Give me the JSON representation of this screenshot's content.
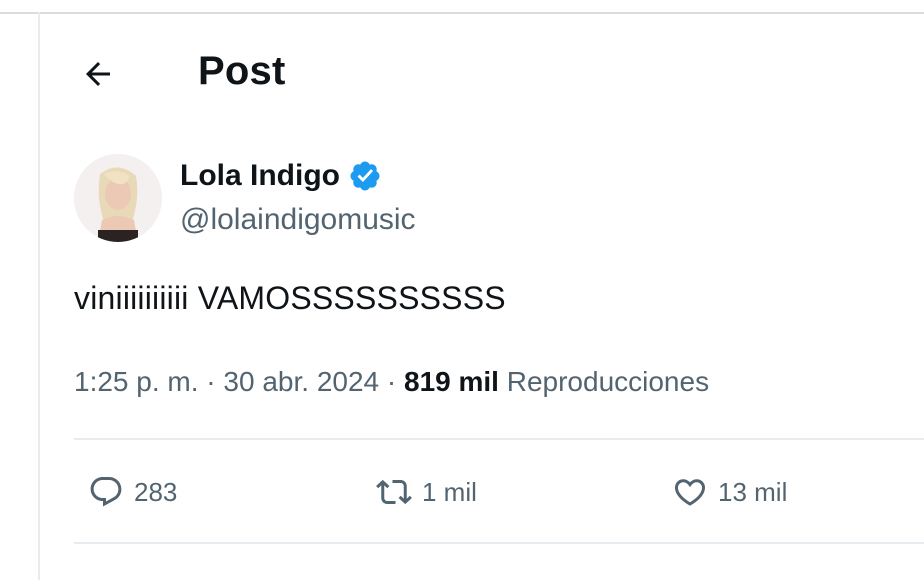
{
  "header": {
    "title": "Post",
    "back_icon": "arrow-left-icon"
  },
  "author": {
    "name": "Lola Indigo",
    "handle": "@lolaindigomusic",
    "verified": true,
    "verified_color": "#1d9bf0"
  },
  "post": {
    "text": "viniiiiiiiiii VAMOSSSSSSSSSS",
    "time": "1:25 p. m.",
    "separator": "·",
    "date": "30 abr. 2024",
    "views_count": "819 mil",
    "views_label": "Reproducciones"
  },
  "actions": {
    "reply": {
      "icon": "reply-icon",
      "count": "283"
    },
    "repost": {
      "icon": "repost-icon",
      "count": "1 mil"
    },
    "like": {
      "icon": "heart-icon",
      "count": "13 mil"
    }
  },
  "colors": {
    "text_primary": "#0f1419",
    "text_secondary": "#536471",
    "divider": "#e6ecf0"
  }
}
